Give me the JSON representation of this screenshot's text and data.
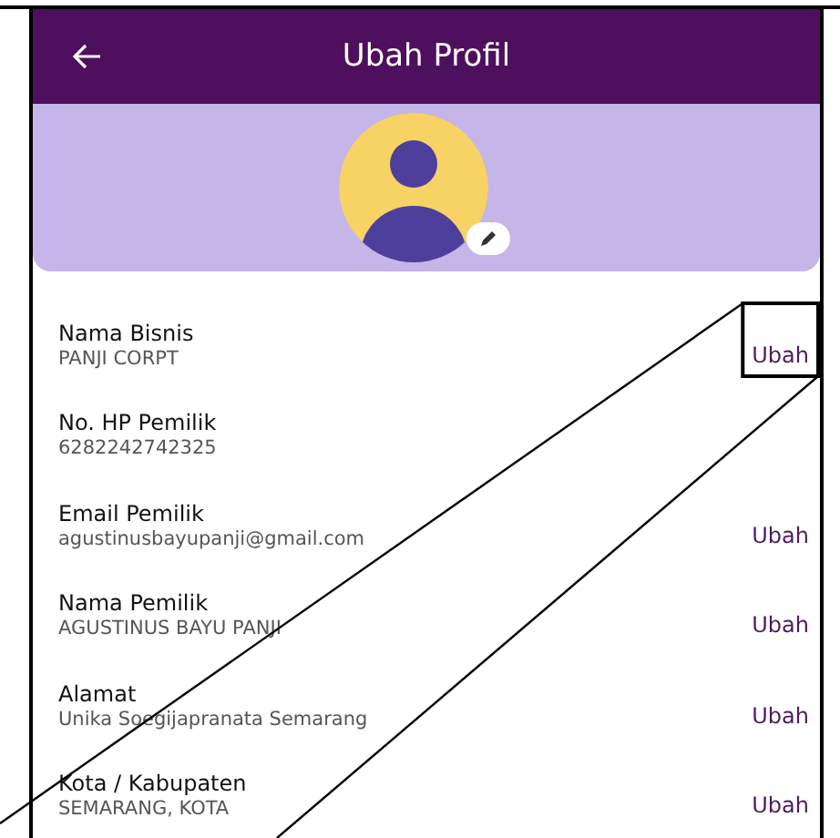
{
  "header": {
    "title": "Ubah Profil"
  },
  "fields": [
    {
      "label": "Nama Bisnis",
      "value": "PANJI CORPT",
      "action": "Ubah",
      "highlighted": true
    },
    {
      "label": "No. HP Pemilik",
      "value": "6282242742325",
      "highlighted": false
    },
    {
      "label": "Email Pemilik",
      "value": "agustinusbayupanji@gmail.com",
      "action": "Ubah",
      "highlighted": false
    },
    {
      "label": "Nama Pemilik",
      "value": "AGUSTINUS BAYU PANJI",
      "action": "Ubah",
      "highlighted": false
    },
    {
      "label": "Alamat",
      "value": "Unika Soegijapranata Semarang",
      "action": "Ubah",
      "highlighted": false
    },
    {
      "label": "Kota / Kabupaten",
      "value": "SEMARANG, KOTA",
      "action": "Ubah",
      "highlighted": false
    }
  ]
}
